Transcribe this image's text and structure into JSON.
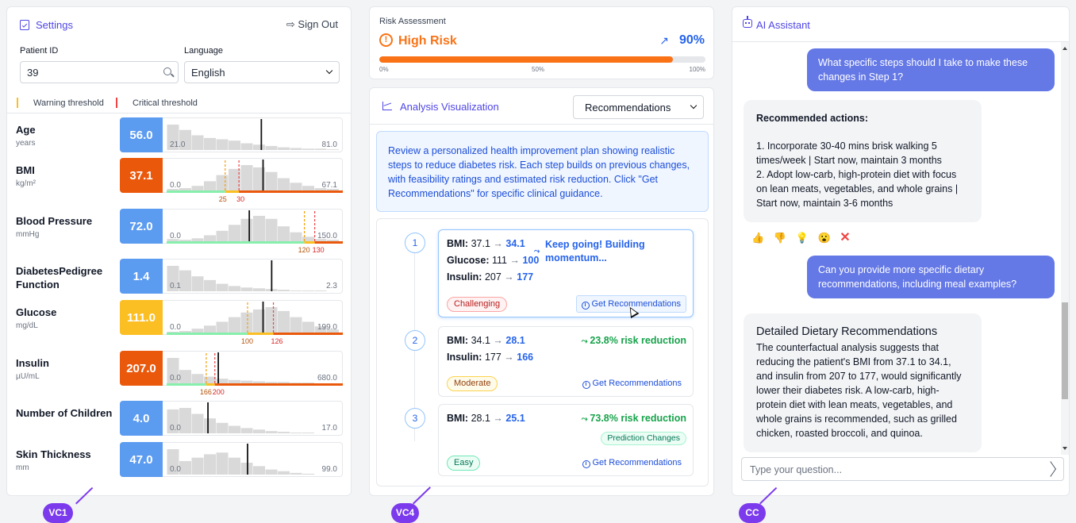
{
  "settings": {
    "title": "Settings",
    "sign_out": "Sign Out",
    "patient_id_label": "Patient ID",
    "patient_id_value": "39",
    "language_label": "Language",
    "language_value": "English",
    "warning_threshold": "Warning threshold",
    "critical_threshold": "Critical threshold"
  },
  "features": [
    {
      "name": "Age",
      "unit": "years",
      "value": "56.0",
      "min": "21.0",
      "max": "81.0",
      "status": "normal"
    },
    {
      "name": "BMI",
      "unit": "kg/m²",
      "value": "37.1",
      "min": "0.0",
      "max": "67.1",
      "status": "critical",
      "warn": "25",
      "crit": "30"
    },
    {
      "name": "Blood Pressure",
      "unit": "mmHg",
      "value": "72.0",
      "min": "0.0",
      "max": "150.0",
      "status": "normal",
      "warn": "120",
      "crit": "130"
    },
    {
      "name": "DiabetesPedigree Function",
      "unit": "",
      "value": "1.4",
      "min": "0.1",
      "max": "2.3",
      "status": "normal"
    },
    {
      "name": "Glucose",
      "unit": "mg/dL",
      "value": "111.0",
      "min": "0.0",
      "max": "199.0",
      "status": "warning",
      "warn": "100",
      "crit": "126"
    },
    {
      "name": "Insulin",
      "unit": "µU/mL",
      "value": "207.0",
      "min": "0.0",
      "max": "680.0",
      "status": "critical",
      "warn": "166",
      "crit": "200"
    },
    {
      "name": "Number of Children",
      "unit": "",
      "value": "4.0",
      "min": "0.0",
      "max": "17.0",
      "status": "normal"
    },
    {
      "name": "Skin Thickness",
      "unit": "mm",
      "value": "47.0",
      "min": "0.0",
      "max": "99.0",
      "status": "normal"
    }
  ],
  "colors": {
    "normal": "#5b9bf0",
    "warning": "#fbbf24",
    "critical": "#ea580c",
    "accent": "#4f46e5"
  },
  "risk": {
    "title": "Risk Assessment",
    "level": "High Risk",
    "percent": "90%",
    "progress": 0.9,
    "tick_0": "0%",
    "tick_50": "50%",
    "tick_100": "100%"
  },
  "viz": {
    "title": "Analysis Visualization",
    "view": "Recommendations",
    "info": "Review a personalized health improvement plan showing realistic steps to reduce diabetes risk. Each step builds on previous changes, with feasibility ratings and estimated risk reduction. Click \"Get Recommendations\" for specific clinical guidance.",
    "get_rec": "Get Recommendations",
    "steps": [
      {
        "num": "1",
        "changes": [
          {
            "f": "BMI:",
            "from": "37.1",
            "to": "34.1"
          },
          {
            "f": "Glucose:",
            "from": "111",
            "to": "100"
          },
          {
            "f": "Insulin:",
            "from": "207",
            "to": "177"
          }
        ],
        "note": "Keep going! Building momentum...",
        "difficulty": "Challenging"
      },
      {
        "num": "2",
        "changes": [
          {
            "f": "BMI:",
            "from": "34.1",
            "to": "28.1"
          },
          {
            "f": "Insulin:",
            "from": "177",
            "to": "166"
          }
        ],
        "note": "23.8% risk reduction",
        "difficulty": "Moderate"
      },
      {
        "num": "3",
        "changes": [
          {
            "f": "BMI:",
            "from": "28.1",
            "to": "25.1"
          }
        ],
        "note": "73.8% risk reduction",
        "badge": "Prediction Changes",
        "difficulty": "Easy"
      }
    ]
  },
  "chat": {
    "title": "AI Assistant",
    "messages": [
      {
        "role": "user",
        "text": "What specific steps should I take to make these changes in Step 1?"
      },
      {
        "role": "bot",
        "heading": "Recommended actions:",
        "lines": [
          "1. Incorporate 30-40 mins brisk walking 5 times/week | Start now, maintain 3 months",
          "2. Adopt low-carb, high-protein diet with focus on lean meats, vegetables, and whole grains | Start now, maintain 3-6 months"
        ]
      },
      {
        "role": "user",
        "text": "Can you provide more specific dietary recommendations, including meal examples?"
      },
      {
        "role": "bot",
        "heading": "Detailed Dietary Recommendations",
        "text": "The counterfactual analysis suggests that reducing the patient's BMI from 37.1 to 34.1, and insulin from 207 to 177, would significantly lower their diabetes risk. A low-carb, high-protein diet with lean meats, vegetables, and whole grains is recommended, such as grilled chicken, roasted broccoli, and quinoa."
      }
    ],
    "feedback": [
      "👍",
      "👎",
      "💡",
      "😮",
      "✕"
    ],
    "input_placeholder": "Type your question..."
  },
  "labels": {
    "vc1": "VC1",
    "vc4": "VC4",
    "cc": "CC"
  }
}
